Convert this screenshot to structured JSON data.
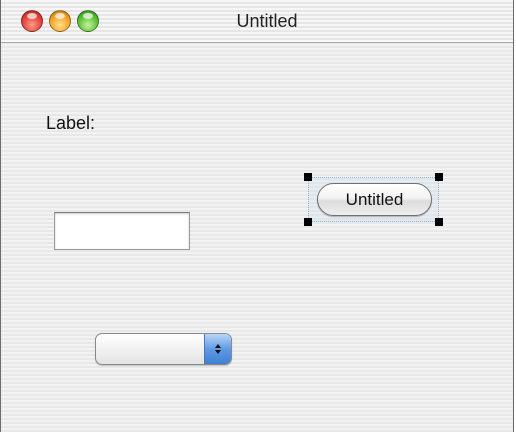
{
  "window": {
    "title": "Untitled",
    "controls": [
      "close-icon",
      "minimize-icon",
      "zoom-icon"
    ]
  },
  "content": {
    "label_text": "Label:",
    "text_field_value": "",
    "push_button_label": "Untitled",
    "popup_selected_value": "",
    "selected_element": "push-button"
  },
  "colors": {
    "close": "#e0443a",
    "minimize": "#f2a52a",
    "zoom": "#5cc238",
    "popup_accent": "#5f9be3",
    "selection_handle": "#000000"
  }
}
